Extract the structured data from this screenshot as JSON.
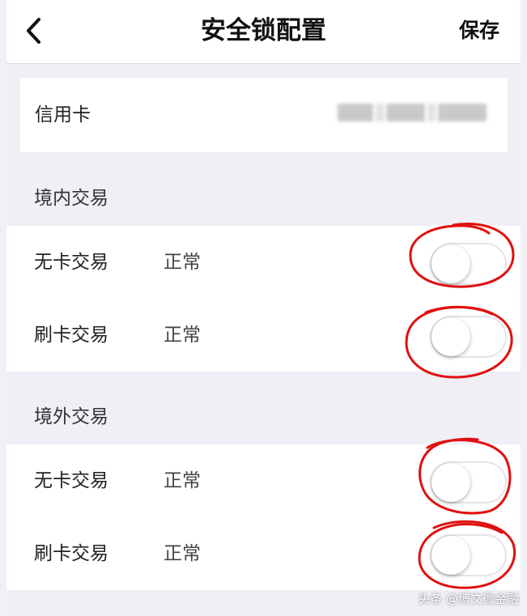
{
  "nav": {
    "title": "安全锁配置",
    "save_label": "保存"
  },
  "card": {
    "label": "信用卡"
  },
  "sections": [
    {
      "title": "境内交易",
      "rows": [
        {
          "label": "无卡交易",
          "status": "正常",
          "enabled": false
        },
        {
          "label": "刷卡交易",
          "status": "正常",
          "enabled": false
        }
      ]
    },
    {
      "title": "境外交易",
      "rows": [
        {
          "label": "无卡交易",
          "status": "正常",
          "enabled": false
        },
        {
          "label": "刷卡交易",
          "status": "正常",
          "enabled": false
        }
      ]
    }
  ],
  "watermark": "头条 @博文微金融",
  "colors": {
    "annotation": "#e01010",
    "background": "#efeff5",
    "surface": "#ffffff"
  },
  "icons": {
    "back": "chevron-left-icon"
  }
}
